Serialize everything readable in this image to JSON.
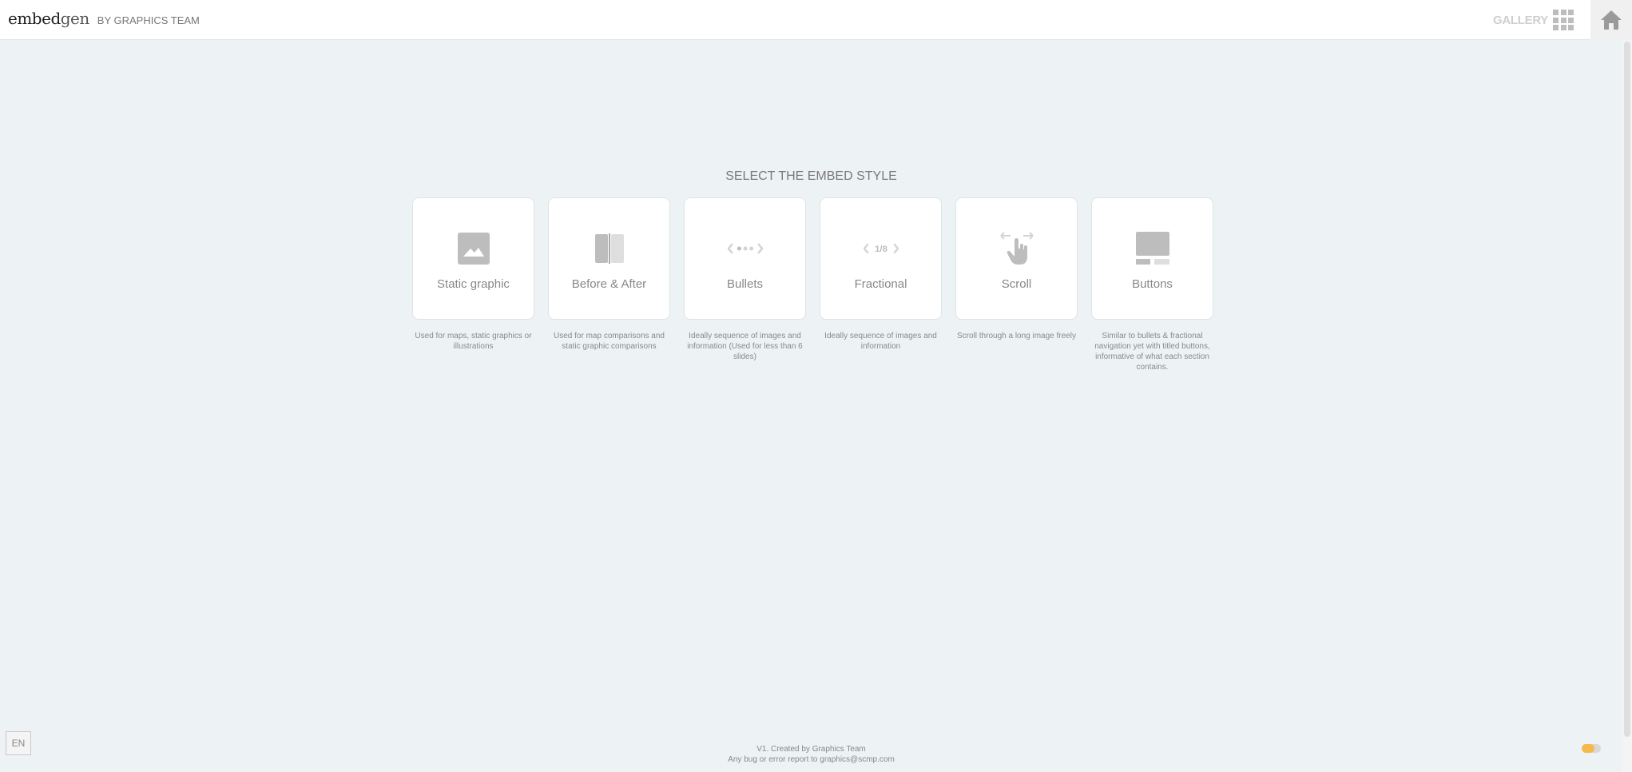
{
  "header": {
    "brand_embed": "embed",
    "brand_gen": "gen",
    "brand_subtitle": "BY GRAPHICS TEAM",
    "gallery_label": "GALLERY"
  },
  "main": {
    "title": "SELECT THE EMBED STYLE",
    "styles": [
      {
        "label": "Static graphic",
        "icon": "image-icon",
        "description": "Used for maps, static graphics or illustrations"
      },
      {
        "label": "Before & After",
        "icon": "split-panel-icon",
        "description": "Used for map comparisons and static graphic comparisons"
      },
      {
        "label": "Bullets",
        "icon": "bullet-dots-icon",
        "description": "Ideally sequence of images and information (Used for less than 6 slides)"
      },
      {
        "label": "Fractional",
        "icon": "fraction-counter-icon",
        "fraction_text": "1/8",
        "description": "Ideally sequence of images and information"
      },
      {
        "label": "Scroll",
        "icon": "hand-scroll-icon",
        "description": "Scroll through a long image freely"
      },
      {
        "label": "Buttons",
        "icon": "titled-buttons-icon",
        "description": "Similar to bullets & fractional navigation yet with titled buttons, informative of what each section contains."
      }
    ]
  },
  "footer": {
    "line1": "V1. Created by Graphics Team",
    "line2": "Any bug or error report to graphics@scmp.com",
    "language": "EN"
  },
  "colors": {
    "background": "#edf2f4",
    "card": "#ffffff",
    "icon": "#bdbdbd",
    "toggle_accent": "#f5b94c"
  }
}
